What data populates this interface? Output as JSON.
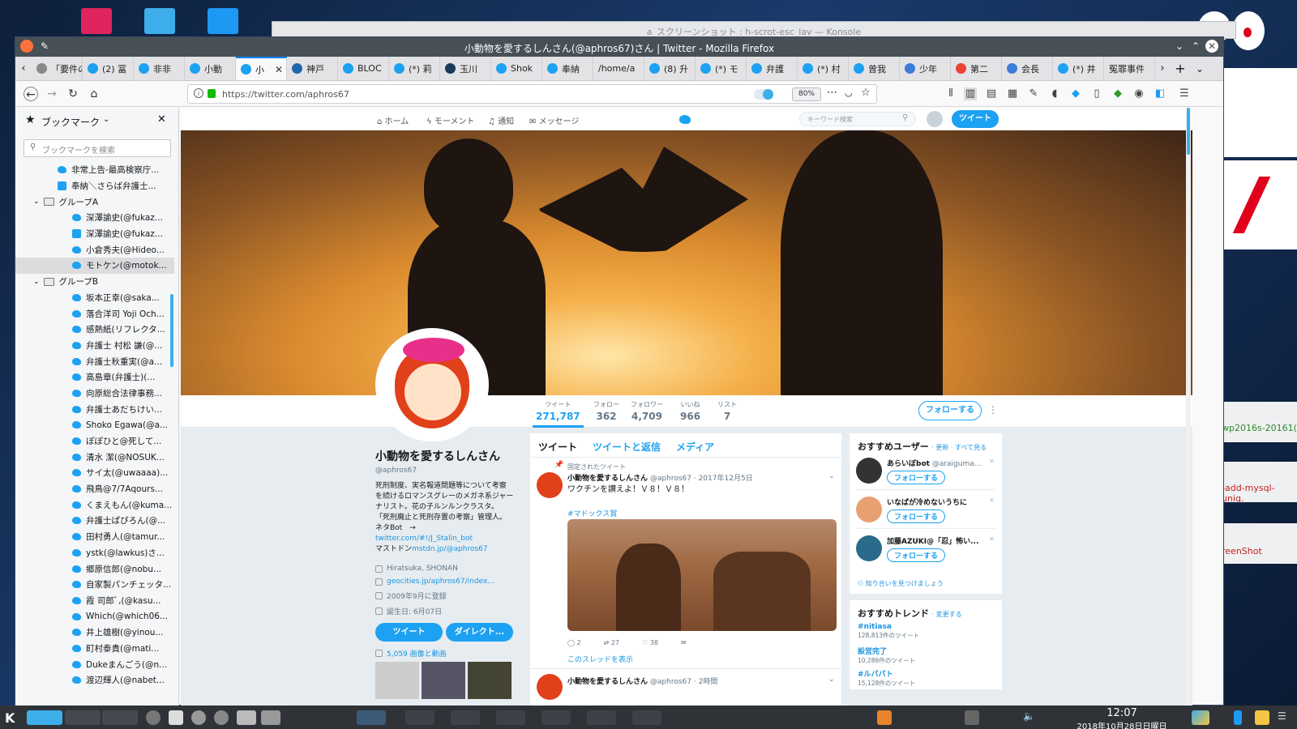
{
  "konsole": {
    "title": "a_スクリーンショット : h-scrot-esc_lav — Konsole"
  },
  "window": {
    "title": "小動物を愛するしんさん(@aphros67)さん | Twitter - Mozilla Firefox"
  },
  "tabs": [
    {
      "label": "「要件の?",
      "color": "#888"
    },
    {
      "label": "(2) 冨",
      "color": "#1da1f2"
    },
    {
      "label": "非非",
      "color": "#1da1f2"
    },
    {
      "label": "小動",
      "color": "#1da1f2"
    },
    {
      "label": "小",
      "color": "#1da1f2",
      "active": true
    },
    {
      "label": "神戸",
      "color": "#2266aa"
    },
    {
      "label": "BLOC",
      "color": "#1da1f2"
    },
    {
      "label": "(*) 莉",
      "color": "#1da1f2"
    },
    {
      "label": "玉川",
      "color": "#1a3a5a"
    },
    {
      "label": "Shok",
      "color": "#1da1f2"
    },
    {
      "label": "奉納",
      "color": "#1da1f2"
    },
    {
      "label": "/home/a",
      "color": ""
    },
    {
      "label": "(8) 升",
      "color": "#1da1f2"
    },
    {
      "label": "(*) モ",
      "color": "#1da1f2"
    },
    {
      "label": "弁護",
      "color": "#1da1f2"
    },
    {
      "label": "(*) 村",
      "color": "#1da1f2"
    },
    {
      "label": "曾我",
      "color": "#1da1f2"
    },
    {
      "label": "少年",
      "color": "#3b7dd8"
    },
    {
      "label": "第二",
      "color": "#ea4335"
    },
    {
      "label": "会長",
      "color": "#3b7dd8"
    },
    {
      "label": "(*) 井",
      "color": "#1da1f2"
    },
    {
      "label": "冤罪事件",
      "color": ""
    }
  ],
  "urlbar": {
    "url": "https://twitter.com/aphros67",
    "zoom": "80%"
  },
  "sidebar": {
    "title": "ブックマーク",
    "search_placeholder": "ブックマークを検索",
    "items": [
      {
        "label": "非常上告-最高検察庁...",
        "type": "bird",
        "indent": 2
      },
      {
        "label": "奉納＼さらば弁護士...",
        "type": "sq",
        "indent": 2
      },
      {
        "label": "グループA",
        "type": "folder",
        "indent": 1
      },
      {
        "label": "深澤諭史(@fukaz...",
        "type": "bird",
        "indent": 3
      },
      {
        "label": "深澤諭史(@fukaz...",
        "type": "sq",
        "indent": 3
      },
      {
        "label": "小倉秀夫(@Hideo...",
        "type": "bird",
        "indent": 3
      },
      {
        "label": "モトケン(@motok...",
        "type": "bird",
        "indent": 3,
        "selected": true
      },
      {
        "label": "グループB",
        "type": "folder",
        "indent": 1
      },
      {
        "label": "坂本正幸(@saka...",
        "type": "bird",
        "indent": 3
      },
      {
        "label": "落合洋司 Yoji Och...",
        "type": "bird",
        "indent": 3
      },
      {
        "label": "感熱紙(リフレクタ...",
        "type": "bird",
        "indent": 3
      },
      {
        "label": "弁護士 村松 謙(@...",
        "type": "bird",
        "indent": 3
      },
      {
        "label": "弁護士秋重実(@a...",
        "type": "bird",
        "indent": 3
      },
      {
        "label": "高島章(弁護士)(...",
        "type": "bird",
        "indent": 3
      },
      {
        "label": "向原総合法律事務...",
        "type": "bird",
        "indent": 3
      },
      {
        "label": "弁護士あだちけい...",
        "type": "bird",
        "indent": 3
      },
      {
        "label": "Shoko Egawa(@a...",
        "type": "bird",
        "indent": 3
      },
      {
        "label": "ぽぽひと@死して...",
        "type": "bird",
        "indent": 3
      },
      {
        "label": "清水 潔(@NOSUK...",
        "type": "bird",
        "indent": 3
      },
      {
        "label": "サイ太(@uwaaaa)...",
        "type": "bird",
        "indent": 3
      },
      {
        "label": "飛鳥@7/7Aqours...",
        "type": "bird",
        "indent": 3
      },
      {
        "label": "くまえもん(@kuma...",
        "type": "bird",
        "indent": 3
      },
      {
        "label": "弁護士ぱぴろん(@...",
        "type": "bird",
        "indent": 3
      },
      {
        "label": "田村勇人(@tamur...",
        "type": "bird",
        "indent": 3
      },
      {
        "label": "ystk(@lawkus)さ...",
        "type": "bird",
        "indent": 3
      },
      {
        "label": "郷原信郎(@nobu...",
        "type": "bird",
        "indent": 3
      },
      {
        "label": "自家製パンチェッタ...",
        "type": "bird",
        "indent": 3
      },
      {
        "label": "霞 司郎ﾞ,(@kasu...",
        "type": "bird",
        "indent": 3
      },
      {
        "label": "Which(@which06...",
        "type": "bird",
        "indent": 3
      },
      {
        "label": "井上雄樹(@yinou...",
        "type": "bird",
        "indent": 3
      },
      {
        "label": "町村泰貴(@mati...",
        "type": "bird",
        "indent": 3
      },
      {
        "label": "Dukeまんごう(@n...",
        "type": "bird",
        "indent": 3
      },
      {
        "label": "渡辺輝人(@nabet...",
        "type": "bird",
        "indent": 3
      }
    ]
  },
  "twitter_nav": {
    "home": "ホーム",
    "moments": "モーメント",
    "notifications": "通知",
    "messages": "メッセージ",
    "search_placeholder": "キーワード検索",
    "tweet_button": "ツイート"
  },
  "stats": [
    {
      "label": "ツイート",
      "value": "271,787",
      "active": true
    },
    {
      "label": "フォロー",
      "value": "362"
    },
    {
      "label": "フォロワー",
      "value": "4,709"
    },
    {
      "label": "いいね",
      "value": "966"
    },
    {
      "label": "リスト",
      "value": "7"
    }
  ],
  "follow_button": "フォローする",
  "profile": {
    "name": "小動物を愛するしんさん",
    "handle": "@aphros67",
    "bio_lines": [
      "死刑制度、実名報道問題等について考察",
      "を続けるロマンスグレーのメガネ系ジャー",
      "ナリスト。花の子ルンルンクラスタ。",
      "「死刑廃止と死刑存置の考察」管理人。"
    ],
    "bot_label": "ネタBot　→",
    "bot_link": "twitter.com/#!/J_Stalin_bot",
    "mastodon_label": "マストドン",
    "mastodon_link": "mstdn.jp/@aphros67",
    "location": "Hiratsuka, SHONAN",
    "website": "geocities.jp/aphros67/index...",
    "joined": "2009年9月に登録",
    "birthday": "誕生日: 6月07日",
    "tweet_btn": "ツイート",
    "dm_btn": "ダイレクト...",
    "media_link": "5,059 画像と動画"
  },
  "timeline": {
    "tabs": [
      "ツイート",
      "ツイートと返信",
      "メディア"
    ],
    "pinned_label": "固定されたツイート",
    "tweet1": {
      "name": "小動物を愛するしんさん",
      "handle": "@aphros67",
      "date": "· 2017年12月5日",
      "text": "ワクチンを讃えよ！Ｖ８！Ｖ８！",
      "hashtag": "#マドックス賞",
      "replies": "2",
      "retweets": "27",
      "likes": "38",
      "thread": "このスレッドを表示"
    },
    "tweet2": {
      "name": "小動物を愛するしんさん",
      "handle": "@aphros67",
      "date": "· 2時間"
    }
  },
  "recommend": {
    "title": "おすすめユーザー",
    "links": "· 更新 · すべて見る",
    "users": [
      {
        "name": "あらいぼbot",
        "handle": "@araiguma...",
        "btn": "フォローする"
      },
      {
        "name": "いなばが冷めないうちに",
        "handle": "",
        "btn": "フォローする"
      },
      {
        "name": "加藤AZUKI@「忍」怖い...",
        "handle": "",
        "btn": "フォローする"
      }
    ],
    "find_friends": "知り合いを見つけましょう"
  },
  "trends": {
    "title": "おすすめトレンド",
    "change": "· 変更する",
    "items": [
      {
        "tag": "#nitiasa",
        "count": "128,813件のツイート"
      },
      {
        "tag": "設営完了",
        "count": "10,286件のツイート"
      },
      {
        "tag": "#ルパパト",
        "count": "15,128件のツイート"
      }
    ]
  },
  "right_windows": {
    "item1": "wp2016s-20161(",
    "item2": "-add-mysql-uniq.",
    "item3": "reenShot"
  },
  "clock": {
    "time": "12:07",
    "date": "2018年10月28日日曜日"
  }
}
